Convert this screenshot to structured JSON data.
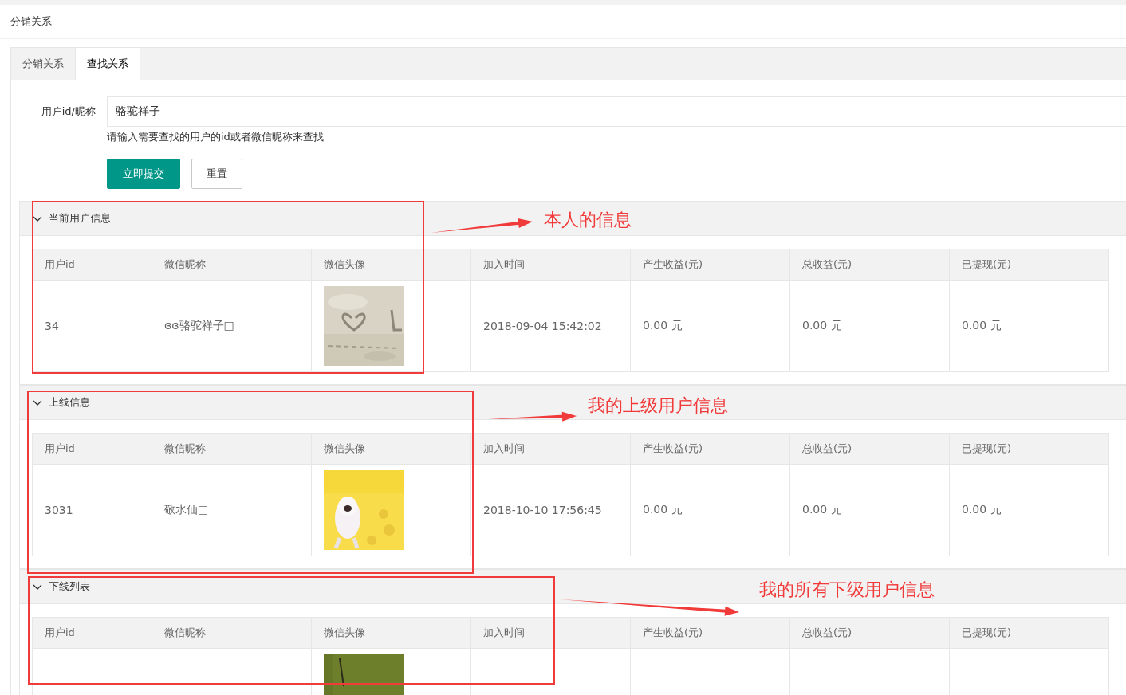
{
  "header": {
    "title": "分销关系"
  },
  "tabs": [
    {
      "label": "分销关系",
      "selected": false
    },
    {
      "label": "查找关系",
      "selected": true
    }
  ],
  "search_form": {
    "label": "用户id/昵称",
    "value": "骆驼祥子",
    "hint": "请输入需要查找的用户的id或者微信昵称来查找",
    "buttons": [
      {
        "label": "立即提交",
        "kind": "primary"
      },
      {
        "label": "重置",
        "kind": "default"
      }
    ]
  },
  "panels": [
    {
      "title": "当前用户信息",
      "expanded": true,
      "columns": [
        "用户id",
        "微信昵称",
        "微信头像",
        "加入时间",
        "产生收益(元)",
        "总收益(元)",
        "已提现(元)"
      ],
      "rows": [
        {
          "user_id": "34",
          "nickname": "ɞɞ骆驼祥子□",
          "join_time": "2018-09-04 15:42:02",
          "income": "0.00 元",
          "total_income": "0.00 元",
          "withdrawn": "0.00 元"
        }
      ]
    },
    {
      "title": "上线信息",
      "expanded": true,
      "columns": [
        "用户id",
        "微信昵称",
        "微信头像",
        "加入时间",
        "产生收益(元)",
        "总收益(元)",
        "已提现(元)"
      ],
      "rows": [
        {
          "user_id": "3031",
          "nickname": "敬水仙□",
          "join_time": "2018-10-10 17:56:45",
          "income": "0.00 元",
          "total_income": "0.00 元",
          "withdrawn": "0.00 元"
        }
      ]
    },
    {
      "title": "下线列表",
      "expanded": true,
      "columns": [
        "用户id",
        "微信昵称",
        "微信头像",
        "加入时间",
        "产生收益(元)",
        "总收益(元)",
        "已提现(元)"
      ]
    }
  ],
  "annotations": [
    {
      "text": "本人的信息"
    },
    {
      "text": "我的上级用户信息"
    },
    {
      "text": "我的所有下级用户信息"
    }
  ]
}
